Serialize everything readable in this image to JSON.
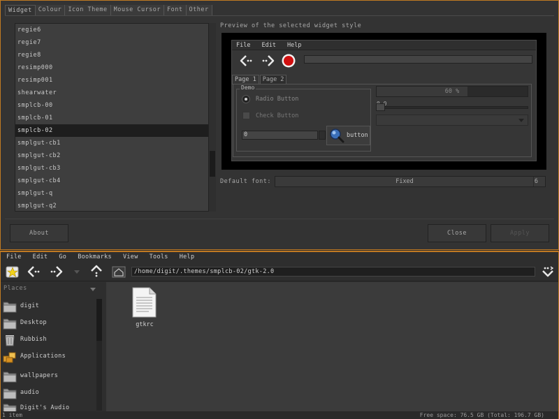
{
  "config": {
    "tabs": [
      "Widget",
      "Colour",
      "Icon Theme",
      "Mouse Cursor",
      "Font",
      "Other"
    ],
    "theme_list": [
      "regie6",
      "regie7",
      "regie8",
      "resimp000",
      "resimp001",
      "shearwater",
      "smplcb-00",
      "smplcb-01",
      "smplcb-02",
      "smplgut-cb1",
      "smplgut-cb2",
      "smplgut-cb3",
      "smplgut-cb4",
      "smplgut-q",
      "smplgut-q2"
    ],
    "selected_theme": "smplcb-02",
    "preview_label": "Preview of the selected widget style",
    "preview": {
      "menus": [
        "File",
        "Edit",
        "Help"
      ],
      "tabs": [
        "Page 1",
        "Page 2"
      ],
      "demo_label": "Demo",
      "radio_label": "Radio Button",
      "check_label": "Check Button",
      "spin_value": "0",
      "button_label": "button",
      "progress_text": "60 %",
      "progress_fraction": 0.6,
      "scale_value": "0.0"
    },
    "font_label": "Default font:",
    "font_name": "Fixed",
    "font_size": "6",
    "about_button": "About",
    "close_button": "Close",
    "apply_button": "Apply"
  },
  "fm": {
    "menus": [
      "File",
      "Edit",
      "Go",
      "Bookmarks",
      "View",
      "Tools",
      "Help"
    ],
    "path": "/home/digit/.themes/smplcb-02/gtk-2.0",
    "places_header": "Places",
    "places": [
      {
        "label": "digit",
        "icon": "folder-icon"
      },
      {
        "label": "Desktop",
        "icon": "folder-icon"
      },
      {
        "label": "Rubbish",
        "icon": "trash-icon"
      },
      {
        "label": "Applications",
        "icon": "applications-icon"
      },
      {
        "label": "wallpapers",
        "icon": "folder-icon"
      },
      {
        "label": "audio",
        "icon": "folder-icon"
      },
      {
        "label": "Digit's Audio",
        "icon": "folder-icon"
      }
    ],
    "files": [
      {
        "name": "gtkrc",
        "icon": "text-file-icon"
      }
    ],
    "status_left": "1 item",
    "status_right": "Free space: 76.5 GB (Total: 196.7 GB)"
  }
}
